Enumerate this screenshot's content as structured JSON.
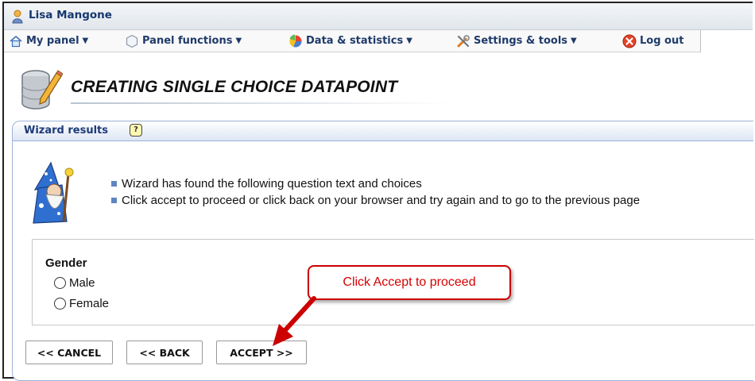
{
  "user": {
    "name": "Lisa Mangone"
  },
  "menu": [
    {
      "label": "My panel",
      "icon": "home-icon"
    },
    {
      "label": "Panel functions",
      "icon": "hexagon-icon"
    },
    {
      "label": "Data & statistics",
      "icon": "pie-chart-icon"
    },
    {
      "label": "Settings & tools",
      "icon": "tools-icon"
    },
    {
      "label": "Log out",
      "icon": "logout-icon"
    }
  ],
  "page": {
    "title": "CREATING SINGLE CHOICE DATAPOINT"
  },
  "wizard": {
    "panel_title": "Wizard results",
    "help_glyph": "?",
    "messages": [
      "Wizard has found the following question text and choices",
      "Click accept to proceed or click back on your browser and try again and to go to the previous page"
    ],
    "question": {
      "label": "Gender",
      "choices": [
        "Male",
        "Female"
      ]
    }
  },
  "buttons": {
    "cancel": "<< CANCEL",
    "back": "<< BACK",
    "accept": "ACCEPT >>"
  },
  "callout": {
    "text": "Click Accept to proceed"
  },
  "colors": {
    "menu_text": "#1f3a6a",
    "panel_border": "#9db3d8",
    "callout_red": "#d60000",
    "bullet_blue": "#5d86c0"
  }
}
